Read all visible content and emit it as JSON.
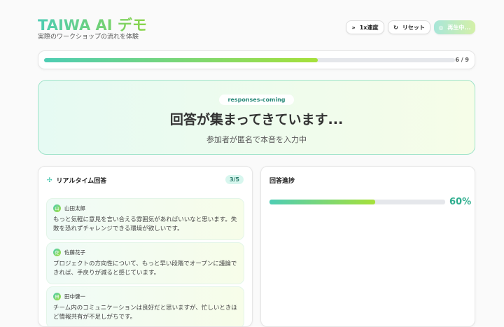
{
  "header": {
    "title": "TAIWA AI デモ",
    "subtitle": "実際のワークショップの流れを体験"
  },
  "toolbar": {
    "speed_label": "1x速度",
    "reset_label": "リセット",
    "play_label": "再生中..."
  },
  "progress": {
    "current": 6,
    "total": 9,
    "label": "6 / 9",
    "fraction": 0.667
  },
  "hero": {
    "badge": "responses-coming",
    "heading": "回答が集まってきています...",
    "description": "参加者が匿名で本音を入力中"
  },
  "responses": {
    "title": "リアルタイム回答",
    "count": "3/5",
    "items": [
      {
        "initial": "山",
        "name": "山田太郎",
        "text": "もっと気軽に意見を言い合える雰囲気があればいいなと思います。失敗を恐れずチャレンジできる環境が欲しいです。"
      },
      {
        "initial": "佐",
        "name": "佐藤花子",
        "text": "プロジェクトの方向性について、もっと早い段階でオープンに議論できれば、手戻りが減ると感じています。"
      },
      {
        "initial": "田",
        "name": "田中健一",
        "text": "チーム内のコミュニケーションは良好だと思いますが、忙しいときほど情報共有が不足しがちです。"
      }
    ]
  },
  "answer_progress": {
    "title": "回答進捗",
    "percent_label": "60%",
    "fraction": 0.6
  }
}
